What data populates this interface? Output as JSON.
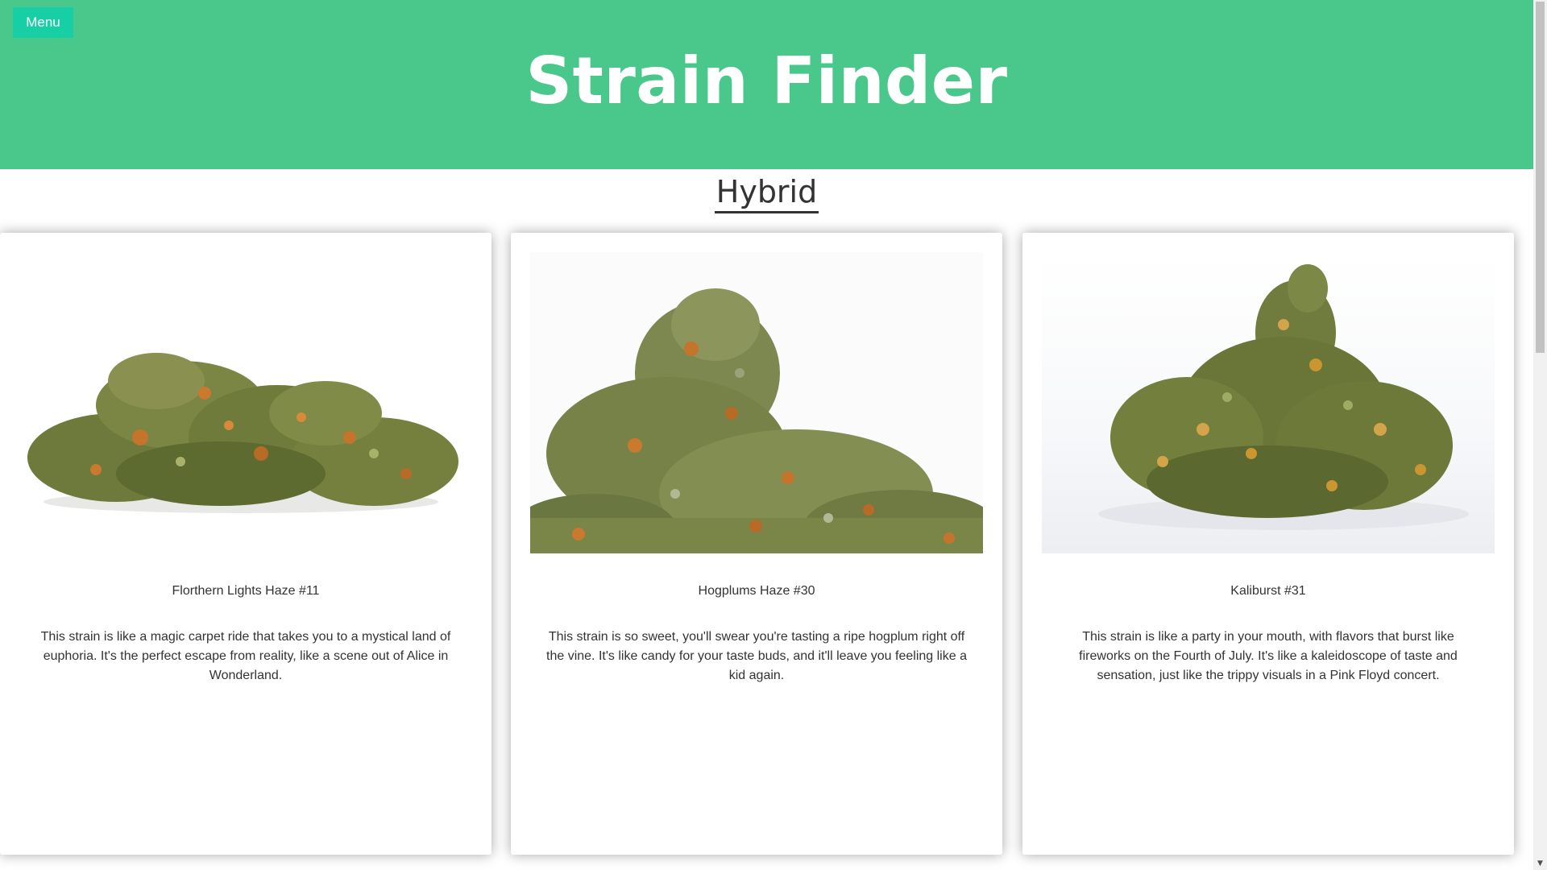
{
  "header": {
    "menu_label": "Menu",
    "title": "Strain Finder",
    "background_color": "#4ac88c",
    "menu_color": "#16cfa4"
  },
  "category": {
    "heading": "Hybrid"
  },
  "strains": [
    {
      "name": "Florthern Lights Haze #11",
      "description": "This strain is like a magic carpet ride that takes you to a mystical land of euphoria. It's the perfect escape from reality, like a scene out of Alice in Wonderland.",
      "image_icon": "cannabis-bud-image"
    },
    {
      "name": "Hogplums Haze #30",
      "description": "This strain is so sweet, you'll swear you're tasting a ripe hogplum right off the vine. It's like candy for your taste buds, and it'll leave you feeling like a kid again.",
      "image_icon": "cannabis-bud-image"
    },
    {
      "name": "Kaliburst #31",
      "description": "This strain is like a party in your mouth, with flavors that burst like fireworks on the Fourth of July. It's like a kaleidoscope of taste and sensation, just like the trippy visuals in a Pink Floyd concert.",
      "image_icon": "cannabis-bud-image"
    }
  ]
}
